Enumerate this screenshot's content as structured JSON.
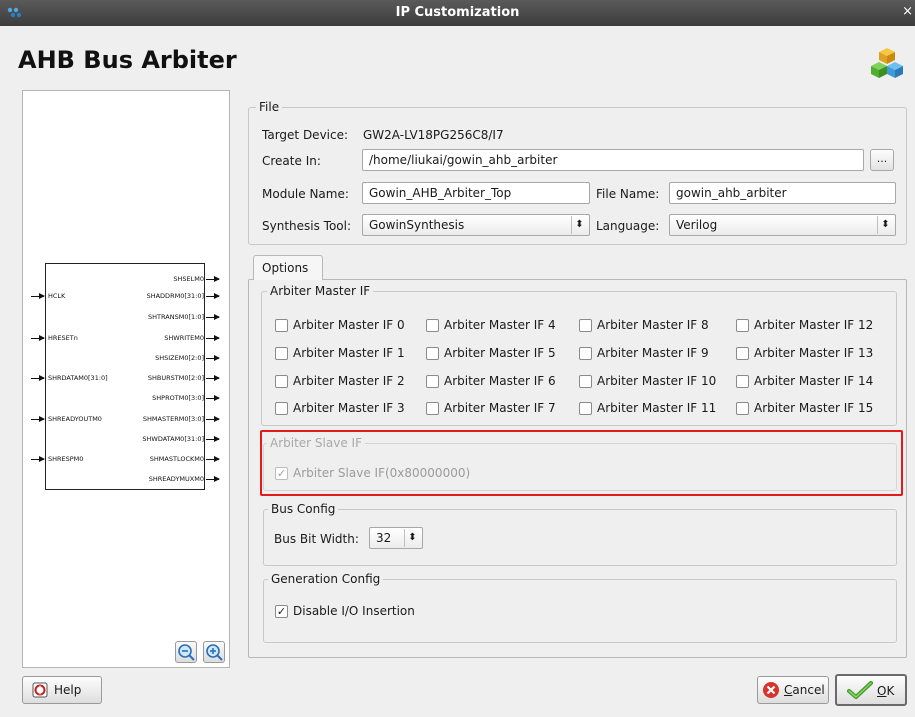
{
  "window": {
    "title": "IP Customization",
    "close_glyph": "×"
  },
  "heading": "AHB Bus Arbiter",
  "preview": {
    "left_ports": [
      "HCLK",
      "HRESETn",
      "SHRDATAM0[31:0]",
      "SHREADYOUTM0",
      "SHRESPM0"
    ],
    "right_ports": [
      "SHSELM0",
      "SHADDRM0[31:0]",
      "SHTRANSM0[1:0]",
      "SHWRITEM0",
      "SHSIZEM0[2:0]",
      "SHBURSTM0[2:0]",
      "SHPROTM0[3:0]",
      "SHMASTERM0[3:0]",
      "SHWDATAM0[31:0]",
      "SHMASTLOCKM0",
      "SHREADYMUXM0"
    ],
    "zoom_out_icon": "zoom-out-icon",
    "zoom_in_icon": "zoom-in-icon"
  },
  "file": {
    "group_label": "File",
    "target_device_label": "Target Device:",
    "target_device_value": "GW2A-LV18PG256C8/I7",
    "create_in_label": "Create In:",
    "create_in_value": "/home/liukai/gowin_ahb_arbiter",
    "browse_label": "...",
    "module_name_label": "Module Name:",
    "module_name_value": "Gowin_AHB_Arbiter_Top",
    "file_name_label": "File Name:",
    "file_name_value": "gowin_ahb_arbiter",
    "synthesis_tool_label": "Synthesis Tool:",
    "synthesis_tool_value": "GowinSynthesis",
    "language_label": "Language:",
    "language_value": "Verilog",
    "combo_glyph": "⬍"
  },
  "options": {
    "tab_label": "Options",
    "master_group_label": "Arbiter Master IF",
    "masters": [
      "Arbiter Master IF 0",
      "Arbiter Master IF 4",
      "Arbiter Master IF 8",
      "Arbiter Master IF 12",
      "Arbiter Master IF 1",
      "Arbiter Master IF 5",
      "Arbiter Master IF 9",
      "Arbiter Master IF 13",
      "Arbiter Master IF 2",
      "Arbiter Master IF 6",
      "Arbiter Master IF 10",
      "Arbiter Master IF 14",
      "Arbiter Master IF 3",
      "Arbiter Master IF 7",
      "Arbiter Master IF 11",
      "Arbiter Master IF 15"
    ],
    "slave_group_label": "Arbiter Slave IF",
    "slave_checkbox_label": "Arbiter Slave IF(0x80000000)",
    "bus_group_label": "Bus Config",
    "bus_bit_width_label": "Bus Bit Width:",
    "bus_bit_width_value": "32",
    "gen_group_label": "Generation Config",
    "disable_io_label": "Disable I/O Insertion",
    "check_glyph": "✓"
  },
  "buttons": {
    "help_label": "Help",
    "cancel_label": "Cancel",
    "cancel_mnemonic": "C",
    "cancel_rest": "ancel",
    "ok_mnemonic": "O",
    "ok_rest": "K"
  },
  "colors": {
    "highlight": "#e31b1b",
    "titlebar": "#3c3c3c"
  }
}
